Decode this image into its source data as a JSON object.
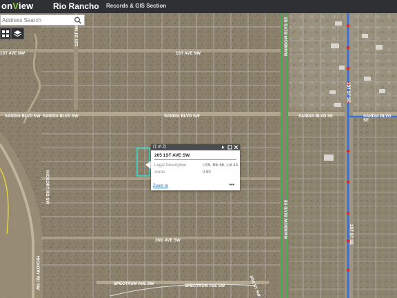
{
  "header": {
    "logo_prefix": "on",
    "logo_mark": "V",
    "logo_suffix": "iew",
    "app_title": "Rio Rancho",
    "section_title": "Records & GIS Section"
  },
  "search": {
    "placeholder": "Address Search"
  },
  "toolbar": {
    "basemap_icon": "grid-icon",
    "layers_icon": "layers-icon"
  },
  "streets": {
    "first_ave_nw": "1ST AVE NW",
    "sandia_sw_left": "SANDIA BLVD SW",
    "sandia_sw_mid": "SANDIA BLVD SW",
    "sandia_se_mid": "SANDIA BLVD SE",
    "sandia_se_right": "SANDIA BLVD SE",
    "rainbow_se_top": "RAINBOW BLVD SE",
    "rainbow_se_bottom": "RAINBOW BLVD SE",
    "first_st_se": "1ST ST SE",
    "first_st_se_bottom": "1ST ST SE",
    "first_st_nw": "1ST ST NW",
    "second_ave_sw": "2ND AVE SW",
    "spectrum_a": "SPECTRUM AVE SW",
    "spectrum_b": "SPECTRUM AVE SW",
    "hickory_a": "HICKORY RD SW",
    "hickory_b": "HICKORY RD SW",
    "curve_rd": "IRIS ST SW"
  },
  "popup": {
    "count": "(1 of 2)",
    "title": "205 1ST AVE SW",
    "fields": [
      {
        "label": "Legal Description",
        "value": "U08, Blk 68, Lot 44"
      },
      {
        "label": "Acres",
        "value": "0.50"
      }
    ],
    "zoom_label": "Zoom to",
    "more_label": "•••"
  },
  "colors": {
    "header_bg": "#2f3033",
    "accent_green": "#8cd04b",
    "selection": "#33e0d0",
    "road_green": "#3fb24a",
    "road_blue": "#3a6fd8"
  }
}
